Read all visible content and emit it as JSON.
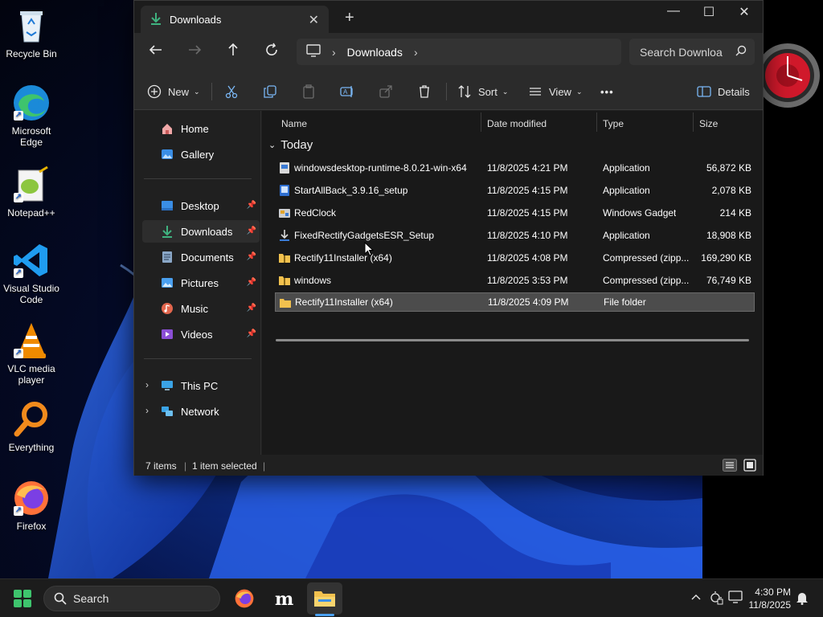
{
  "desktop": {
    "icons": [
      {
        "label": "Recycle Bin",
        "icon": "recycle-bin-icon"
      },
      {
        "label": "Microsoft Edge",
        "icon": "edge-icon"
      },
      {
        "label": "Notepad++",
        "icon": "notepadpp-icon"
      },
      {
        "label": "Visual Studio Code",
        "icon": "vscode-icon"
      },
      {
        "label": "VLC media player",
        "icon": "vlc-icon"
      },
      {
        "label": "Everything",
        "icon": "everything-icon"
      },
      {
        "label": "Firefox",
        "icon": "firefox-icon"
      }
    ]
  },
  "window": {
    "tab_title": "Downloads",
    "tab_close": "✕",
    "new_tab": "+",
    "controls": {
      "minimize": "—",
      "maximize": "☐",
      "close": "✕"
    },
    "address": {
      "segment": "Downloads",
      "separator": "›"
    },
    "search_placeholder": "Search Downloa",
    "commands": {
      "new": "New",
      "sort": "Sort",
      "view": "View",
      "more": "•••",
      "details": "Details"
    }
  },
  "navpane": {
    "items": [
      {
        "label": "Home",
        "icon": "home-icon"
      },
      {
        "label": "Gallery",
        "icon": "gallery-icon"
      },
      {
        "label": "Desktop",
        "icon": "desktop-icon",
        "pinned": true
      },
      {
        "label": "Downloads",
        "icon": "downloads-icon",
        "pinned": true,
        "active": true
      },
      {
        "label": "Documents",
        "icon": "documents-icon",
        "pinned": true
      },
      {
        "label": "Pictures",
        "icon": "pictures-icon",
        "pinned": true
      },
      {
        "label": "Music",
        "icon": "music-icon",
        "pinned": true
      },
      {
        "label": "Videos",
        "icon": "videos-icon",
        "pinned": true
      },
      {
        "label": "This PC",
        "icon": "pc-icon",
        "expandable": true
      },
      {
        "label": "Network",
        "icon": "network-icon",
        "expandable": true
      }
    ]
  },
  "files": {
    "columns": [
      "Name",
      "Date modified",
      "Type",
      "Size"
    ],
    "group": "Today",
    "rows": [
      {
        "name": "windowsdesktop-runtime-8.0.21-win-x64",
        "date": "11/8/2025 4:21 PM",
        "type": "Application",
        "size": "56,872 KB",
        "icon": "installer-icon"
      },
      {
        "name": "StartAllBack_3.9.16_setup",
        "date": "11/8/2025 4:15 PM",
        "type": "Application",
        "size": "2,078 KB",
        "icon": "app-icon"
      },
      {
        "name": "RedClock",
        "date": "11/8/2025 4:15 PM",
        "type": "Windows Gadget",
        "size": "214 KB",
        "icon": "gadget-icon"
      },
      {
        "name": "FixedRectifyGadgetsESR_Setup",
        "date": "11/8/2025 4:10 PM",
        "type": "Application",
        "size": "18,908 KB",
        "icon": "setup-icon"
      },
      {
        "name": "Rectify11Installer (x64)",
        "date": "11/8/2025 4:08 PM",
        "type": "Compressed (zipp...",
        "size": "169,290 KB",
        "icon": "zip-folder-icon"
      },
      {
        "name": "windows",
        "date": "11/8/2025 3:53 PM",
        "type": "Compressed (zipp...",
        "size": "76,749 KB",
        "icon": "zip-folder-icon"
      },
      {
        "name": "Rectify11Installer (x64)",
        "date": "11/8/2025 4:09 PM",
        "type": "File folder",
        "size": "",
        "icon": "folder-icon",
        "selected": true
      }
    ]
  },
  "status": {
    "items": "7 items",
    "selected": "1 item selected"
  },
  "taskbar": {
    "search": "Search",
    "time": "4:30 PM",
    "date": "11/8/2025"
  },
  "colors": {
    "accent": "#4aa0f0",
    "folder": "#f2c14e",
    "selection": "#4c4c4c"
  }
}
